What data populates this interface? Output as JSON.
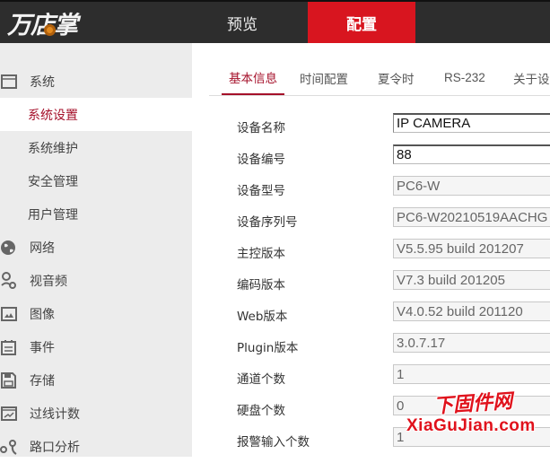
{
  "header": {
    "logo": "万店掌",
    "tabs": [
      {
        "label": "预览",
        "active": false
      },
      {
        "label": "配置",
        "active": true
      }
    ]
  },
  "colors": {
    "accent": "#a5102a",
    "nav_active_bg": "#d8151f",
    "topbar_bg": "#2d2d2d",
    "sidebar_bg": "#ececec"
  },
  "sidebar": {
    "items": [
      {
        "label": "系统",
        "icon": "window-icon",
        "level": 0
      },
      {
        "label": "系统设置",
        "level": 1,
        "active": true
      },
      {
        "label": "系统维护",
        "level": 1
      },
      {
        "label": "安全管理",
        "level": 1
      },
      {
        "label": "用户管理",
        "level": 1
      },
      {
        "label": "网络",
        "icon": "globe-icon",
        "level": 0
      },
      {
        "label": "视音频",
        "icon": "audio-video-icon",
        "level": 0
      },
      {
        "label": "图像",
        "icon": "image-icon",
        "level": 0
      },
      {
        "label": "事件",
        "icon": "calendar-icon",
        "level": 0
      },
      {
        "label": "存储",
        "icon": "floppy-disk-icon",
        "level": 0
      },
      {
        "label": "过线计数",
        "icon": "chart-counter-icon",
        "level": 0
      },
      {
        "label": "路口分析",
        "icon": "intersection-icon",
        "level": 0
      }
    ]
  },
  "main": {
    "tabs": [
      {
        "label": "基本信息",
        "active": true
      },
      {
        "label": "时间配置"
      },
      {
        "label": "夏令时"
      },
      {
        "label": "RS-232"
      },
      {
        "label": "关于设"
      }
    ],
    "fields": [
      {
        "label": "设备名称",
        "value": "IP CAMERA",
        "editable": true
      },
      {
        "label": "设备编号",
        "value": "88",
        "editable": true
      },
      {
        "label": "设备型号",
        "value": "PC6-W",
        "editable": false
      },
      {
        "label": "设备序列号",
        "value": "PC6-W20210519AACHG",
        "editable": false
      },
      {
        "label": "主控版本",
        "value": "V5.5.95 build 201207",
        "editable": false
      },
      {
        "label": "编码版本",
        "value": "V7.3 build 201205",
        "editable": false
      },
      {
        "label": "Web版本",
        "value": "V4.0.52 build 201120",
        "editable": false
      },
      {
        "label": "Plugin版本",
        "value": "3.0.7.17",
        "editable": false
      },
      {
        "label": "通道个数",
        "value": "1",
        "editable": false
      },
      {
        "label": "硬盘个数",
        "value": "0",
        "editable": false
      },
      {
        "label": "报警输入个数",
        "value": "1",
        "editable": false
      }
    ]
  },
  "watermark": {
    "cn": "下固件网",
    "en": "XiaGuJian.com"
  }
}
